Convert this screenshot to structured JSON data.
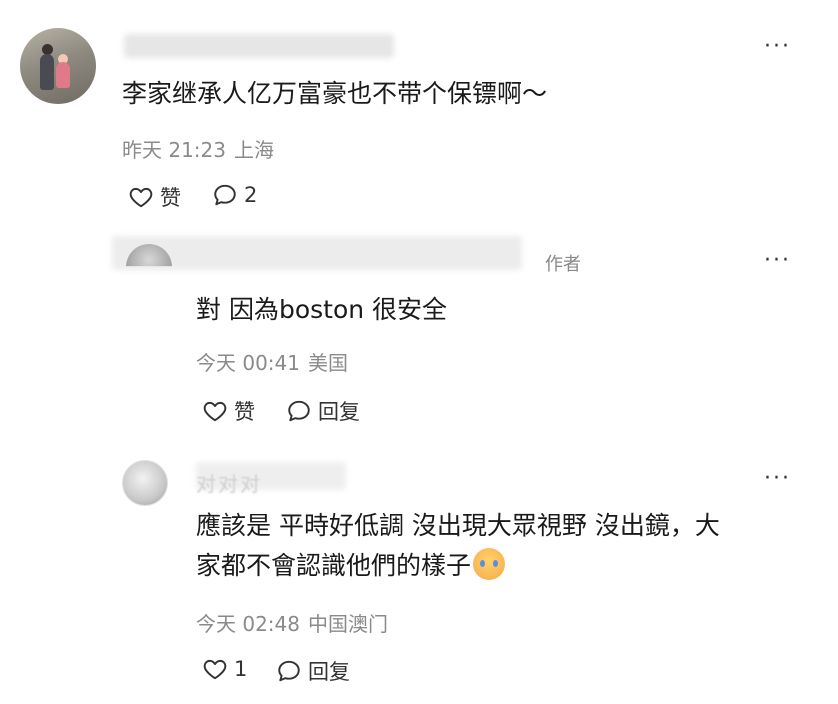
{
  "comments": [
    {
      "text": "李家继承人亿万富豪也不带个保镖啊～",
      "time": "昨天 21:23",
      "location": "上海",
      "like_label": "赞",
      "reply_label": "2"
    },
    {
      "author_tag": "作者",
      "text": "對 因為boston 很安全",
      "time": "今天 00:41",
      "location": "美国",
      "like_label": "赞",
      "reply_label": "回复"
    },
    {
      "author_name": "对对对",
      "text_line1": "應該是 平時好低調 沒出現大眾視野 沒出鏡，大",
      "text_line2": "家都不會認識他們的樣子",
      "emoji": "crying-face-emoji",
      "time": "今天 02:48",
      "location": "中国澳门",
      "like_label": "1",
      "reply_label": "回复"
    }
  ],
  "more_label": "···"
}
